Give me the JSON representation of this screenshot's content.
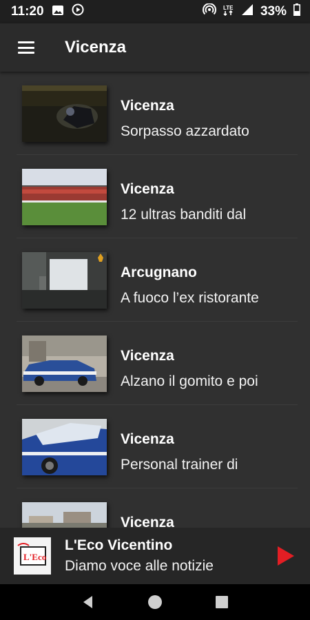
{
  "status_bar": {
    "time": "11:20",
    "battery": "33%",
    "left_icons": [
      "image-icon",
      "play-circle-icon"
    ],
    "right_icons": [
      "hotspot-icon",
      "lte-icon",
      "signal-icon",
      "battery-icon"
    ]
  },
  "app_bar": {
    "title": "Vicenza",
    "menu_icon": "hamburger-menu-icon"
  },
  "news": [
    {
      "city": "Vicenza",
      "headline": "Sorpasso azzardato"
    },
    {
      "city": "Vicenza",
      "headline": "12 ultras banditi dal"
    },
    {
      "city": "Arcugnano",
      "headline": "A fuoco l’ex ristorante"
    },
    {
      "city": "Vicenza",
      "headline": "Alzano il gomito e poi"
    },
    {
      "city": "Vicenza",
      "headline": "Personal trainer di"
    },
    {
      "city": "Vicenza",
      "headline": ""
    }
  ],
  "player": {
    "station": "L'Eco Vicentino",
    "tagline": "Diamo voce alle notizie",
    "logo_text": "L'Eco",
    "play_icon": "play-icon",
    "accent": "#e31e24"
  },
  "nav_bar": {
    "icons": [
      "back-icon",
      "home-icon",
      "recents-icon"
    ]
  }
}
